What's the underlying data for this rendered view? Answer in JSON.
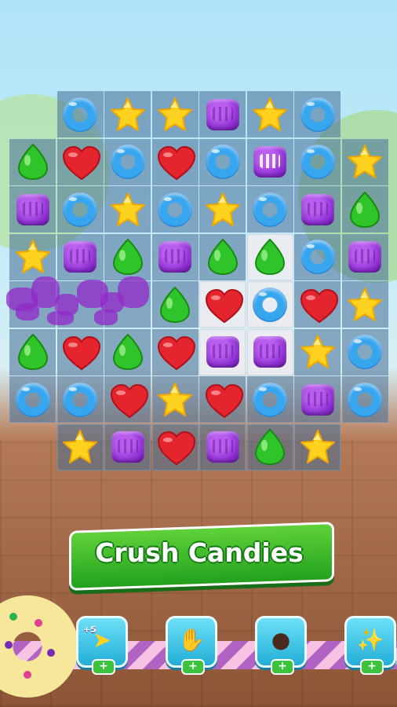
{
  "banner": {
    "title": "Crush Candies"
  },
  "board": {
    "rows": [
      [
        null,
        "ring",
        "star",
        "star",
        "cube",
        "star",
        "ring",
        null
      ],
      [
        "drop",
        "heart",
        "ring",
        "heart",
        "ring",
        "cube-striped",
        "ring",
        "star"
      ],
      [
        "cube",
        "ring",
        "star",
        "ring",
        "star",
        "ring",
        "cube",
        "drop"
      ],
      [
        "star",
        "cube",
        "drop",
        "cube",
        "drop",
        "drop",
        "ring",
        "cube"
      ],
      [
        null,
        null,
        null,
        "drop",
        "heart",
        "ring",
        "heart",
        "star"
      ],
      [
        "drop",
        "heart",
        "drop",
        "heart",
        "cube",
        "cube",
        "star",
        "ring"
      ],
      [
        "ring",
        "ring",
        "heart",
        "star",
        "heart",
        "ring",
        "cube",
        "ring"
      ],
      [
        null,
        "star",
        "cube",
        "heart",
        "cube",
        "drop",
        "star",
        null
      ]
    ],
    "selected": [
      [
        3,
        5
      ],
      [
        4,
        4
      ],
      [
        4,
        5
      ],
      [
        5,
        4
      ],
      [
        5,
        5
      ]
    ]
  },
  "boosters": [
    {
      "name": "extra-moves-booster",
      "icon": "plus-five-moves-icon",
      "tag": "+5",
      "plus": "+"
    },
    {
      "name": "hand-swap-booster",
      "icon": "hand-icon",
      "tag": "",
      "plus": "+"
    },
    {
      "name": "bomb-booster",
      "icon": "bomb-icon",
      "tag": "",
      "plus": "+"
    },
    {
      "name": "magic-wand-booster",
      "icon": "magic-wand-icon",
      "tag": "",
      "plus": "+"
    }
  ],
  "colors": {
    "ring": "#37a6ef",
    "heart": "#e5252e",
    "star": "#ffd21f",
    "drop": "#2fc42a",
    "cube": "#8a2bcf",
    "banner": "#3ab82a",
    "booster": "#34c1e4"
  }
}
